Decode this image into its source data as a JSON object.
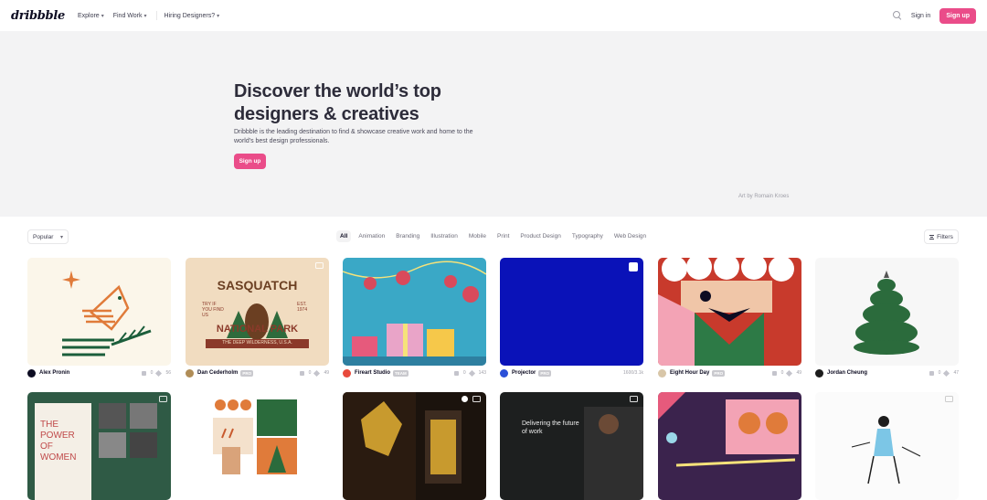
{
  "nav": {
    "logo": "dribbble",
    "items": [
      {
        "label": "Explore"
      },
      {
        "label": "Find Work"
      },
      {
        "label": "Hiring Designers?"
      }
    ],
    "sign_in": "Sign in",
    "sign_up": "Sign up"
  },
  "hero": {
    "title": "Discover the world’s top designers & creatives",
    "description": "Dribbble is the leading destination to find & showcase creative work and home to the world's best design professionals.",
    "cta": "Sign up",
    "art_credit": "Art by Romain Kroes"
  },
  "filters": {
    "sort": "Popular",
    "categories": [
      "All",
      "Animation",
      "Branding",
      "Illustration",
      "Mobile",
      "Print",
      "Product Design",
      "Typography",
      "Web Design"
    ],
    "active_category": "All",
    "filters_button": "Filters"
  },
  "shots": [
    {
      "author": "Alex Pronin",
      "badge": "",
      "comments": "0",
      "likes": "56",
      "avatar_color": "#0d0c22"
    },
    {
      "author": "Dan Cederholm",
      "badge": "PRO",
      "comments": "0",
      "likes": "49",
      "avatar_color": "#b08d57"
    },
    {
      "author": "Fireart Studio",
      "badge": "TEAM",
      "comments": "0",
      "likes": "143",
      "avatar_color": "#e84a3c"
    },
    {
      "author": "Projector",
      "badge": "PRO",
      "comments": "",
      "likes": "",
      "views": "1600/3.1k",
      "avatar_color": "#2b50d8"
    },
    {
      "author": "Eight Hour Day",
      "badge": "PRO",
      "comments": "0",
      "likes": "49",
      "avatar_color": "#d8c6a8"
    },
    {
      "author": "Jordan Cheung",
      "badge": "",
      "comments": "0",
      "likes": "47",
      "avatar_color": "#1d1d1d"
    }
  ],
  "shot_texts": {
    "sasquatch_top": "SASQUATCH",
    "sasquatch_bottom": "NATIONAL PARK",
    "sasquatch_left": "TRY IF YOU FIND US",
    "sasquatch_right": "EST. 1974",
    "sasquatch_ribbon": "THE DEEP WILDERNESS, U.S.A.",
    "women_text": "THE POWER OF WOMEN",
    "delivering_text": "Delivering the future of work"
  }
}
